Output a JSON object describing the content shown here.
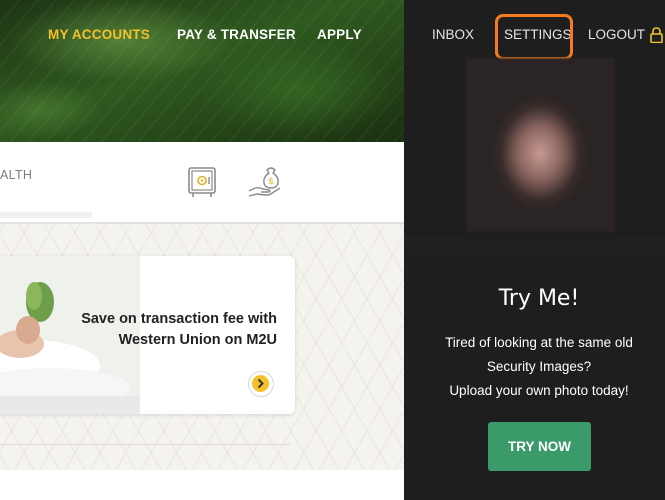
{
  "main_nav": {
    "items": [
      {
        "label": "MY ACCOUNTS",
        "active": true
      },
      {
        "label": "PAY & TRANSFER",
        "active": false
      },
      {
        "label": "APPLY",
        "active": false
      }
    ]
  },
  "user_nav": {
    "inbox": "INBOX",
    "settings": "SETTINGS",
    "logout": "LOGOUT",
    "lock_icon": "lock-icon",
    "highlight_color": "#f47b20"
  },
  "tabs": {
    "partial_label": "ALTH",
    "icons": [
      "safe-icon",
      "money-bag-hand-icon"
    ]
  },
  "promo": {
    "title_line1": "Save on transaction fee with",
    "title_line2": "Western Union on M2U",
    "arrow_icon": "chevron-right-icon",
    "accent": "#f3c12a"
  },
  "security_image": {
    "tryme_title": "Try Me!",
    "line1": "Tired of looking at the same old",
    "line2": "Security Images?",
    "line3": "Upload your own photo today!",
    "button_label": "TRY NOW",
    "button_color": "#3a9a6a"
  },
  "colors": {
    "active_nav": "#f3c12a",
    "panel_bg": "#1e1e1e"
  }
}
